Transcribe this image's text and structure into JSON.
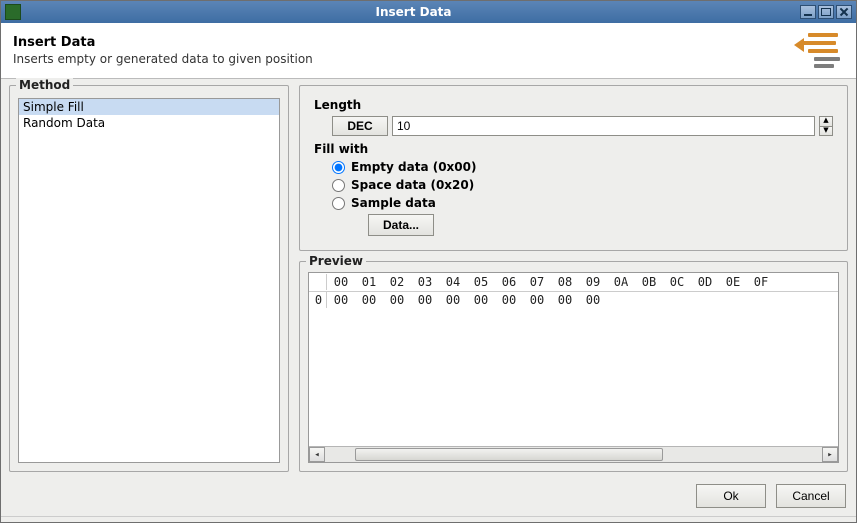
{
  "window": {
    "title": "Insert Data"
  },
  "header": {
    "title": "Insert Data",
    "description": "Inserts empty or generated data to given position"
  },
  "method": {
    "legend": "Method",
    "items": [
      "Simple Fill",
      "Random Data"
    ],
    "selected_index": 0
  },
  "settings": {
    "length_label": "Length",
    "dec_button": "DEC",
    "length_value": "10",
    "fill_label": "Fill with",
    "options": {
      "empty": "Empty data (0x00)",
      "space": "Space data (0x20)",
      "sample": "Sample data"
    },
    "selected_option": "empty",
    "data_button": "Data..."
  },
  "preview": {
    "legend": "Preview",
    "columns": [
      "00",
      "01",
      "02",
      "03",
      "04",
      "05",
      "06",
      "07",
      "08",
      "09",
      "0A",
      "0B",
      "0C",
      "0D",
      "0E",
      "0F"
    ],
    "rows": [
      {
        "offset": "0",
        "bytes": [
          "00",
          "00",
          "00",
          "00",
          "00",
          "00",
          "00",
          "00",
          "00",
          "00"
        ]
      }
    ]
  },
  "footer": {
    "ok": "Ok",
    "cancel": "Cancel"
  }
}
